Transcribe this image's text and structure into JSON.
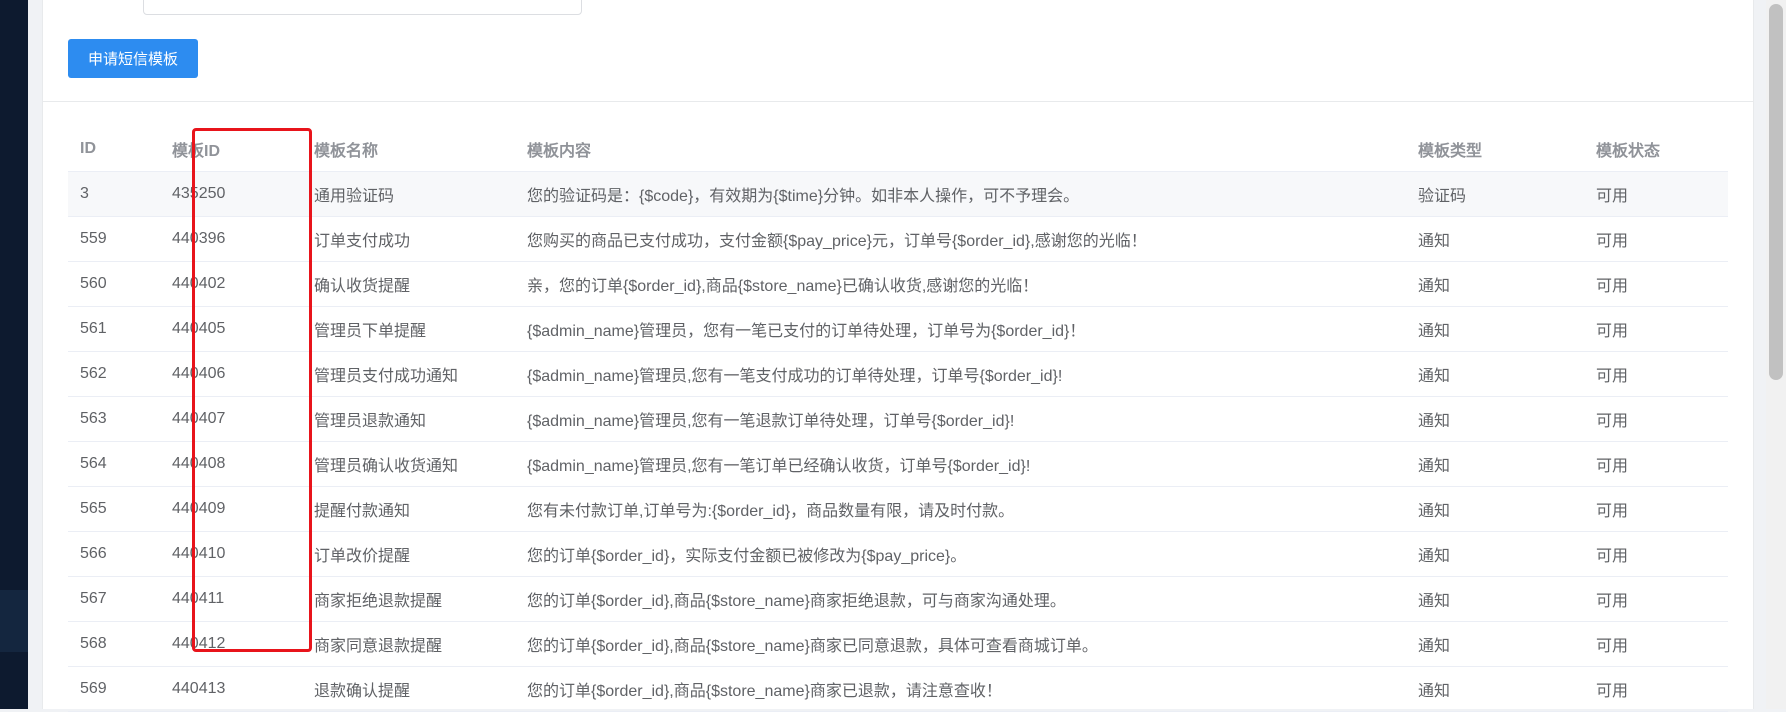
{
  "toolbar": {
    "apply_label": "申请短信模板"
  },
  "table": {
    "headers": [
      "ID",
      "模板ID",
      "模板名称",
      "模板内容",
      "模板类型",
      "模板状态"
    ],
    "rows": [
      [
        "3",
        "435250",
        "通用验证码",
        "您的验证码是：{$code}，有效期为{$time}分钟。如非本人操作，可不予理会。",
        "验证码",
        "可用"
      ],
      [
        "559",
        "440396",
        "订单支付成功",
        "您购买的商品已支付成功，支付金额{$pay_price}元，订单号{$order_id},感谢您的光临！",
        "通知",
        "可用"
      ],
      [
        "560",
        "440402",
        "确认收货提醒",
        "亲，您的订单{$order_id},商品{$store_name}已确认收货,感谢您的光临！",
        "通知",
        "可用"
      ],
      [
        "561",
        "440405",
        "管理员下单提醒",
        "{$admin_name}管理员，您有一笔已支付的订单待处理，订单号为{$order_id}！",
        "通知",
        "可用"
      ],
      [
        "562",
        "440406",
        "管理员支付成功通知",
        "{$admin_name}管理员,您有一笔支付成功的订单待处理，订单号{$order_id}!",
        "通知",
        "可用"
      ],
      [
        "563",
        "440407",
        "管理员退款通知",
        "{$admin_name}管理员,您有一笔退款订单待处理，订单号{$order_id}!",
        "通知",
        "可用"
      ],
      [
        "564",
        "440408",
        "管理员确认收货通知",
        "{$admin_name}管理员,您有一笔订单已经确认收货，订单号{$order_id}!",
        "通知",
        "可用"
      ],
      [
        "565",
        "440409",
        "提醒付款通知",
        "您有未付款订单,订单号为:{$order_id}，商品数量有限，请及时付款。",
        "通知",
        "可用"
      ],
      [
        "566",
        "440410",
        "订单改价提醒",
        "您的订单{$order_id}，实际支付金额已被修改为{$pay_price}。",
        "通知",
        "可用"
      ],
      [
        "567",
        "440411",
        "商家拒绝退款提醒",
        "您的订单{$order_id},商品{$store_name}商家拒绝退款，可与商家沟通处理。",
        "通知",
        "可用"
      ],
      [
        "568",
        "440412",
        "商家同意退款提醒",
        "您的订单{$order_id},商品{$store_name}商家已同意退款，具体可查看商城订单。",
        "通知",
        "可用"
      ],
      [
        "569",
        "440413",
        "退款确认提醒",
        "您的订单{$order_id},商品{$store_name}商家已退款，请注意查收！",
        "通知",
        "可用"
      ]
    ]
  },
  "colors": {
    "primary": "#2d8cf0",
    "highlight": "#e8141b",
    "sidebar": "#0d1a2f"
  }
}
